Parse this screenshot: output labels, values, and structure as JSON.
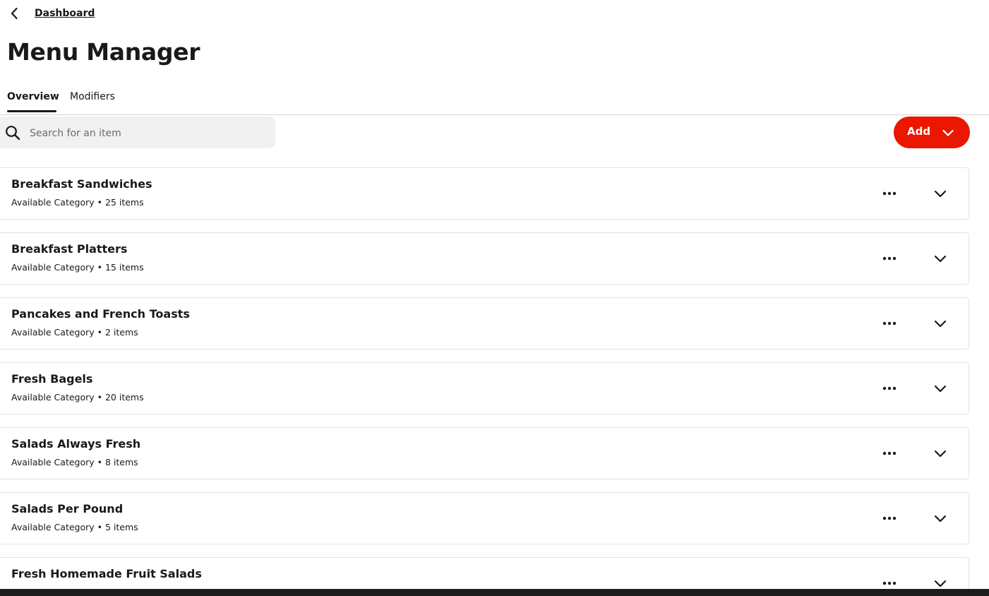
{
  "breadcrumb": {
    "back_icon": "chevron-left-icon",
    "link_label": "Dashboard"
  },
  "page": {
    "title": "Menu Manager"
  },
  "tabs": [
    {
      "label": "Overview",
      "active": true
    },
    {
      "label": "Modifiers",
      "active": false
    }
  ],
  "search": {
    "placeholder": "Search for an item",
    "value": "",
    "icon": "search-icon"
  },
  "add_button": {
    "label": "Add",
    "icon": "chevron-down-icon",
    "color": "#eb1700"
  },
  "categories": [
    {
      "name": "Breakfast Sandwiches",
      "meta": "Available Category • 25 items"
    },
    {
      "name": "Breakfast Platters",
      "meta": "Available Category • 15 items"
    },
    {
      "name": "Pancakes and French Toasts",
      "meta": "Available Category • 2 items"
    },
    {
      "name": "Fresh Bagels",
      "meta": "Available Category • 20 items"
    },
    {
      "name": "Salads Always Fresh",
      "meta": "Available Category • 8 items"
    },
    {
      "name": "Salads Per Pound",
      "meta": "Available Category • 5 items"
    },
    {
      "name": "Fresh Homemade Fruit Salads",
      "meta": ""
    }
  ],
  "row_icons": {
    "more": "more-horizontal-icon",
    "expand": "chevron-down-icon"
  }
}
